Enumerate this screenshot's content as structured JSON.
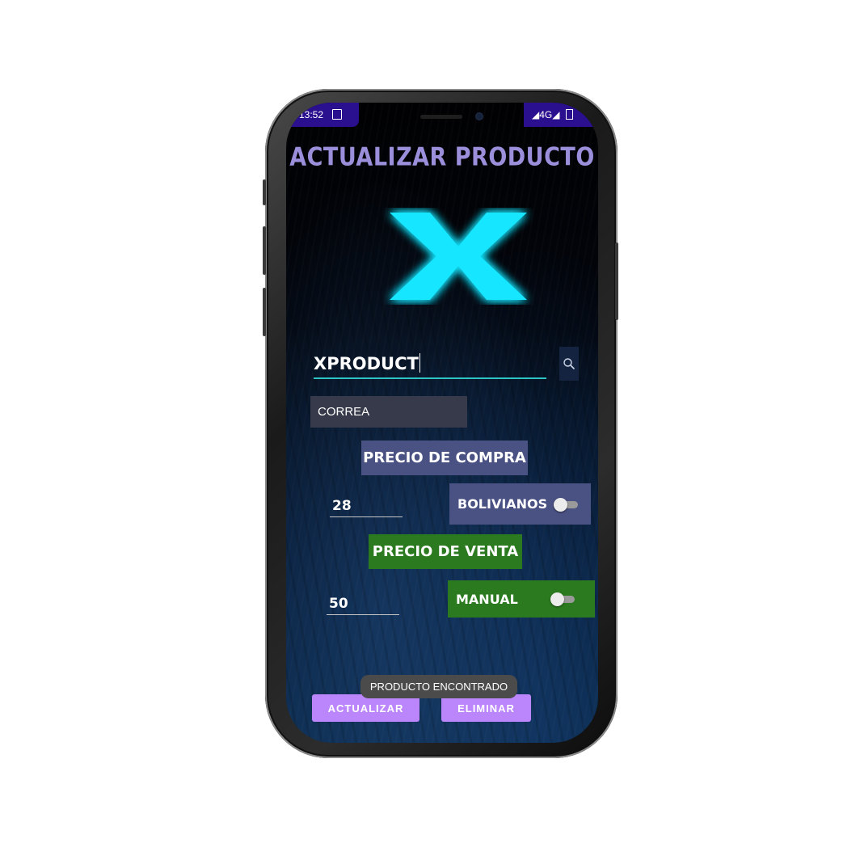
{
  "status_bar": {
    "time": "13:52",
    "left_icons": "sim-card-icon",
    "network": "◢4G◢",
    "right_icons": "battery-icon"
  },
  "screen": {
    "title": "ACTUALIZAR PRODUCTO",
    "logo_icon": "x-logo-icon",
    "logo_color": "#19e6ff"
  },
  "search": {
    "value": "XPRODUCT",
    "icon": "search-icon"
  },
  "product": {
    "name_value": "CORREA"
  },
  "purchase": {
    "label": "PRECIO DE COMPRA",
    "value": "28",
    "currency_toggle_label": "BOLIVIANOS",
    "currency_toggle_on": false
  },
  "sale": {
    "label": "PRECIO DE VENTA",
    "value": "50",
    "mode_toggle_label": "MANUAL",
    "mode_toggle_on": false
  },
  "toast": {
    "message": "PRODUCTO ENCONTRADO"
  },
  "actions": {
    "update_label": "ACTUALIZAR",
    "delete_label": "ELIMINAR"
  },
  "colors": {
    "accent_purple": "#bb86fc",
    "title_color": "#9b8fdc",
    "compra_box": "#4a5183",
    "venta_box": "#2b7a1f",
    "status_bar": "#2a0f8f"
  }
}
